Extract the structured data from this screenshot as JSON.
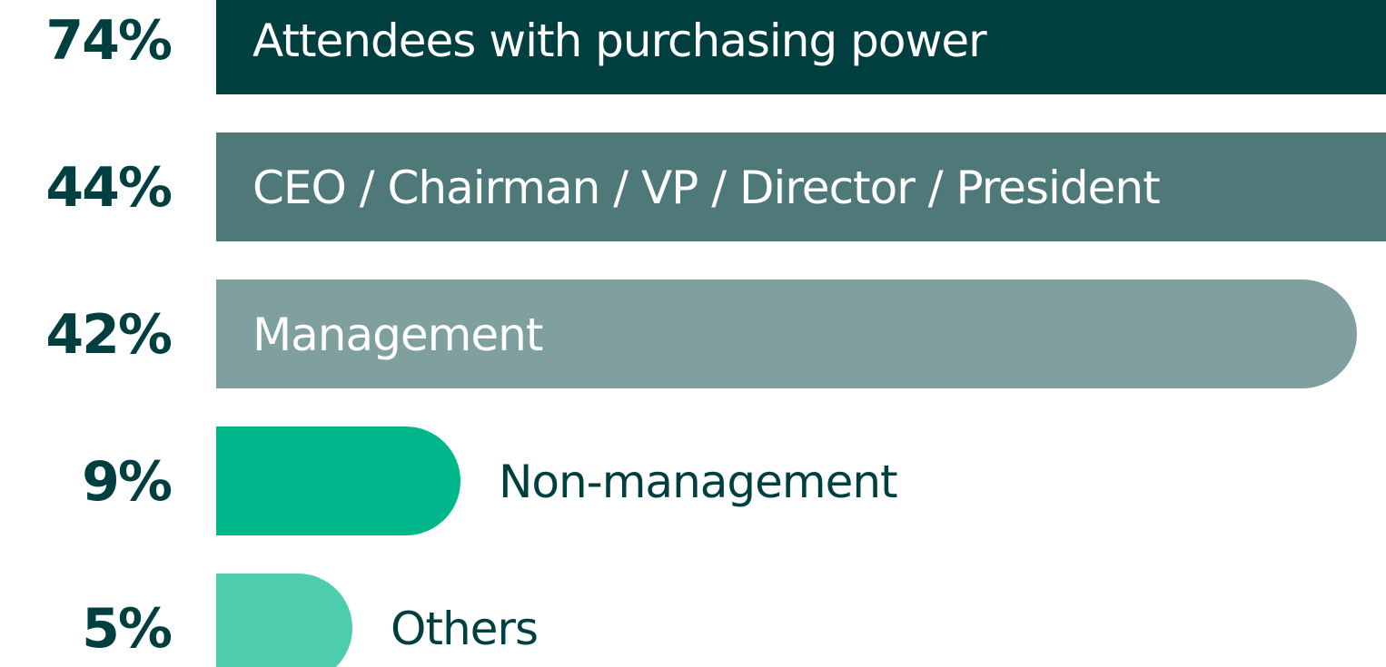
{
  "chart_data": {
    "type": "bar",
    "orientation": "horizontal",
    "categories": [
      "Attendees with purchasing power",
      "CEO / Chairman / VP / Director / President",
      "Management",
      "Non-management",
      "Others"
    ],
    "values": [
      74,
      44,
      42,
      9,
      5
    ],
    "value_labels": [
      "74%",
      "44%",
      "42%",
      "9%",
      "5%"
    ],
    "colors": [
      "#003f3f",
      "#4f7878",
      "#80a09f",
      "#00b78b",
      "#4dcdae"
    ],
    "label_colors": [
      "#ffffff",
      "#ffffff",
      "#ffffff",
      "#003f3f",
      "#003f3f"
    ],
    "title": "",
    "xlabel": "",
    "ylabel": "",
    "grid": false,
    "legend": "none"
  }
}
